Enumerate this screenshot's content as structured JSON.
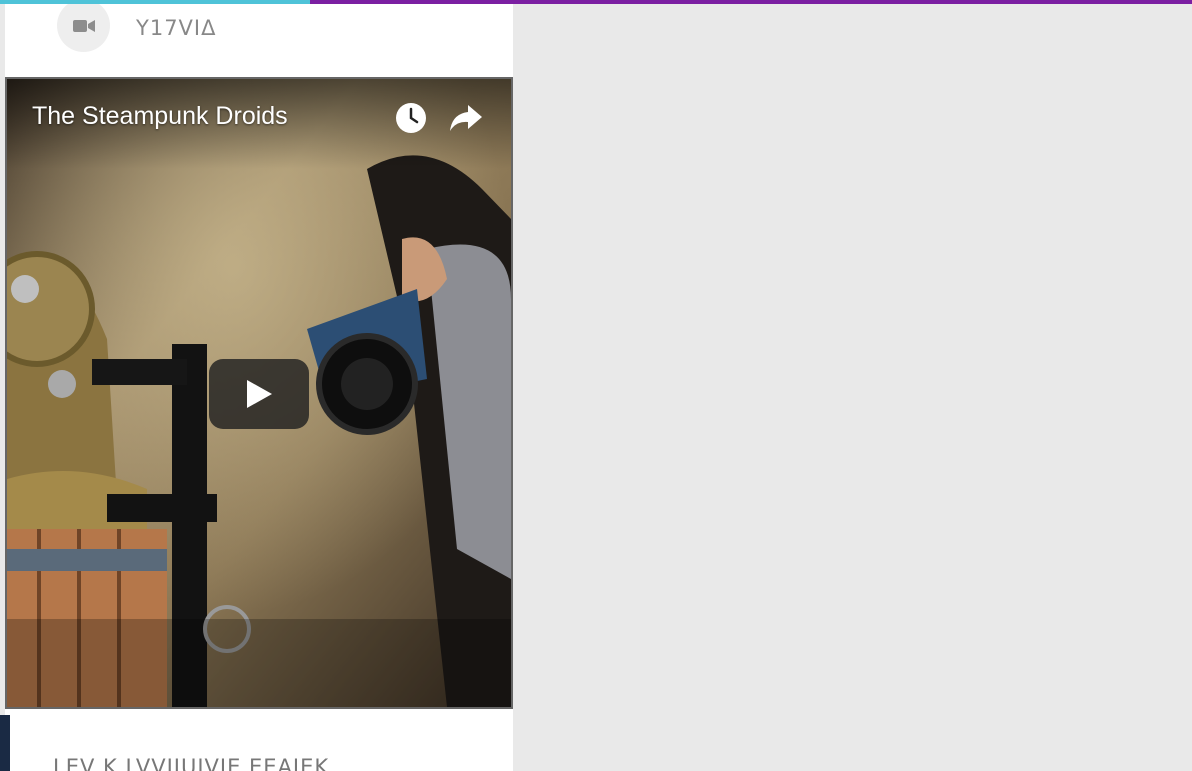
{
  "top_bar": {
    "progress": 0.26,
    "accent_color": "#7b1fa2",
    "progress_color": "#4fc3d8"
  },
  "card_header": {
    "icon": "video-camera-icon",
    "label": "Y17VIΔ"
  },
  "video": {
    "title": "The Steampunk Droids",
    "watch_later_icon": "clock-icon",
    "share_icon": "share-arrow-icon",
    "play_icon": "play-icon"
  },
  "card_footer": {
    "text": "LEV K LVVIJUIVIE EEAIEK"
  }
}
